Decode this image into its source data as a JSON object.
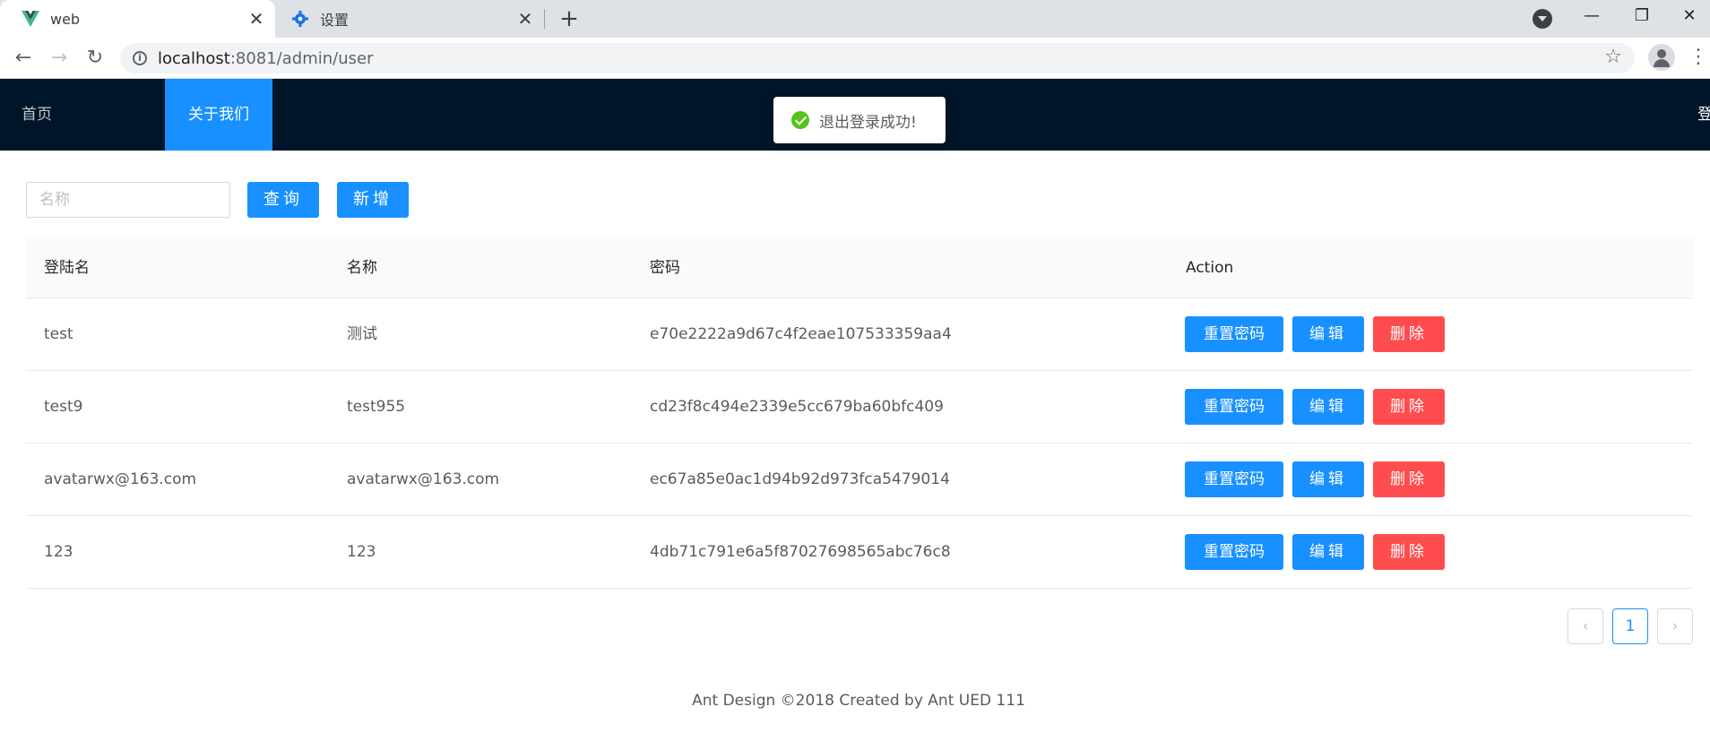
{
  "browser": {
    "tabs": [
      {
        "title": "web",
        "icon": "vue-logo-icon",
        "active": true
      },
      {
        "title": "设置",
        "icon": "gear-icon",
        "active": false
      }
    ],
    "url_host": "localhost",
    "url_rest": ":8081/admin/user"
  },
  "header": {
    "menu": [
      {
        "label": "首页"
      },
      {
        "label": "关于我们",
        "selected": true
      }
    ],
    "login_label": "登录"
  },
  "toast": {
    "text": "退出登录成功!"
  },
  "search": {
    "placeholder": "名称",
    "value": ""
  },
  "toolbar": {
    "query_label": "查询",
    "add_label": "新增"
  },
  "table": {
    "columns": [
      "登陆名",
      "名称",
      "密码",
      "Action"
    ],
    "rows": [
      {
        "login": "test",
        "name": "测试",
        "password": "e70e2222a9d67c4f2eae107533359aa4"
      },
      {
        "login": "test9",
        "name": "test955",
        "password": "cd23f8c494e2339e5cc679ba60bfc409"
      },
      {
        "login": "avatarwx@163.com",
        "name": "avatarwx@163.com",
        "password": "ec67a85e0ac1d94b92d973fca5479014"
      },
      {
        "login": "123",
        "name": "123",
        "password": "4db71c791e6a5f87027698565abc76c8"
      }
    ],
    "actions": {
      "reset": "重置密码",
      "edit": "编辑",
      "delete": "删除"
    }
  },
  "pagination": {
    "prev": "‹",
    "current": "1",
    "next": "›"
  },
  "footer": {
    "text": "Ant Design ©2018 Created by Ant UED 111"
  },
  "colors": {
    "primary": "#1890ff",
    "danger": "#ff4d4f",
    "header_bg": "#001529",
    "success": "#52c41a"
  }
}
